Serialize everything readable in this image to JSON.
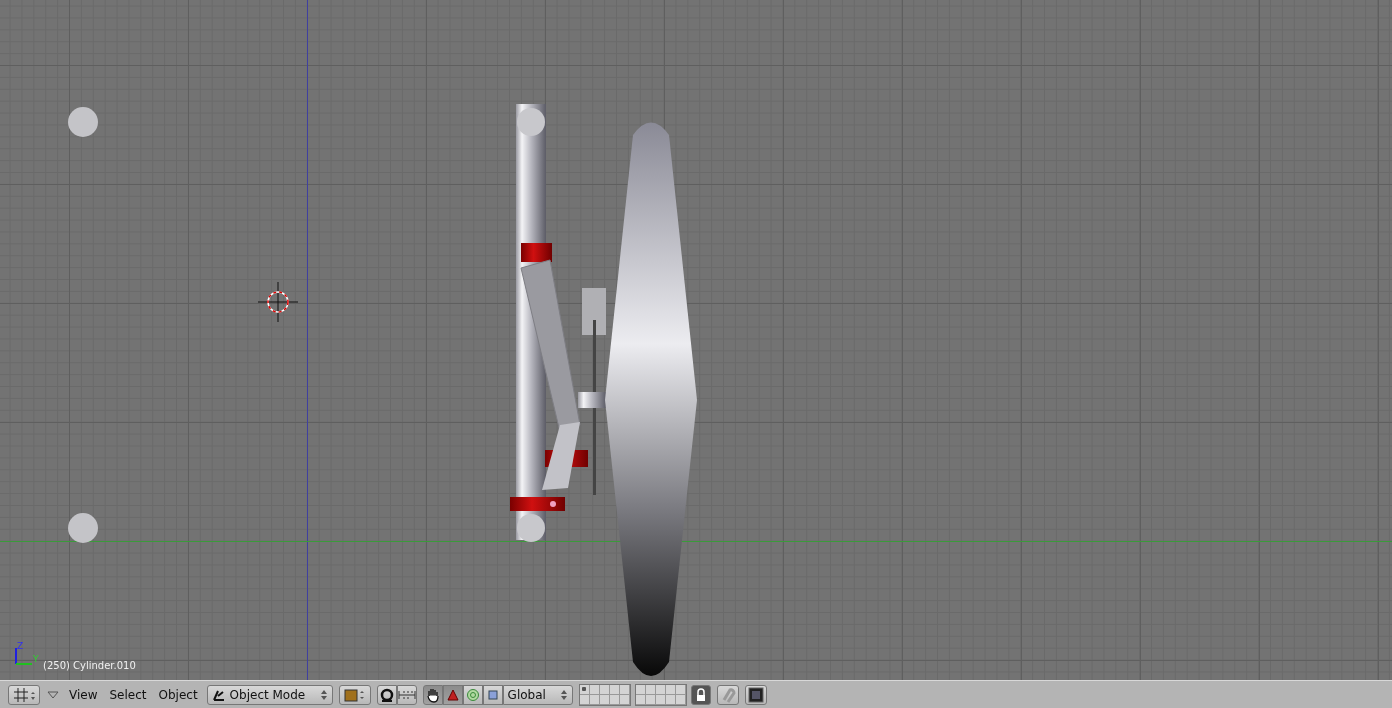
{
  "viewport": {
    "object_info": "(250) Cylinder.010",
    "axis_labels": [
      "Z",
      "Y"
    ]
  },
  "header": {
    "menus": [
      "View",
      "Select",
      "Object"
    ],
    "mode": "Object Mode",
    "orientation": "Global",
    "manipulator_on": true,
    "tools": [
      {
        "kind": "translate",
        "selected": true
      },
      {
        "kind": "rotate",
        "selected": false
      },
      {
        "kind": "scale",
        "selected": false
      }
    ],
    "layers": [
      {
        "selected": true
      },
      {
        "selected": false
      },
      {
        "selected": false
      },
      {
        "selected": false
      },
      {
        "selected": false
      },
      {
        "selected": false
      },
      {
        "selected": false
      },
      {
        "selected": false
      },
      {
        "selected": false
      },
      {
        "selected": false
      },
      {
        "selected": false
      },
      {
        "selected": false
      },
      {
        "selected": false
      },
      {
        "selected": false
      },
      {
        "selected": false
      },
      {
        "selected": false
      },
      {
        "selected": false
      },
      {
        "selected": false
      },
      {
        "selected": false
      },
      {
        "selected": false
      }
    ],
    "layer_lock": {
      "on": true
    }
  }
}
